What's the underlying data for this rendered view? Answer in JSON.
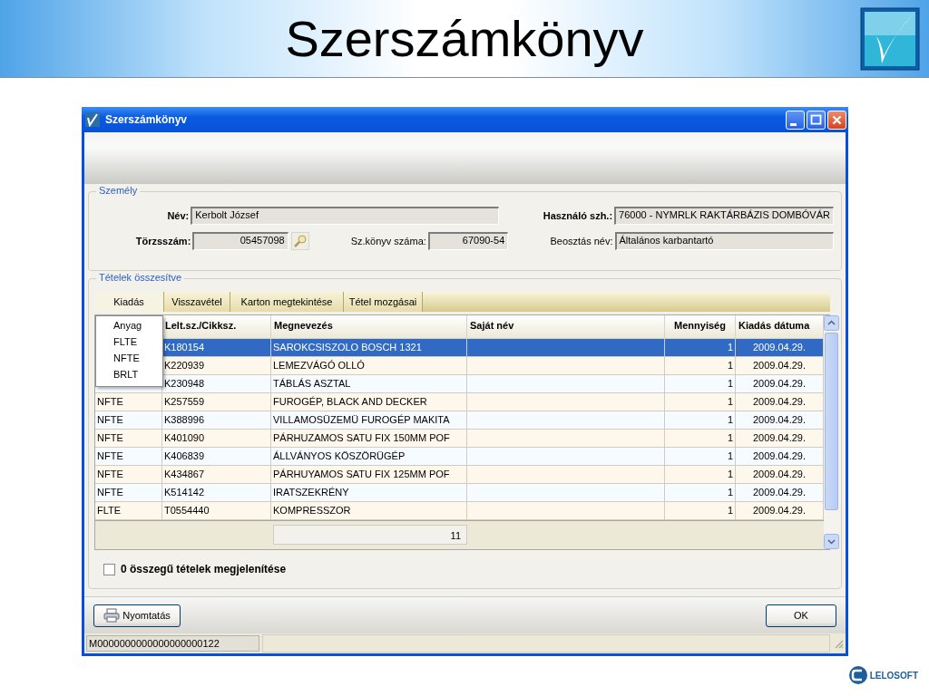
{
  "slide": {
    "title": "Szerszámkönyv",
    "footer_logo": "LELOSOFT"
  },
  "window": {
    "title": "Szerszámkönyv"
  },
  "person": {
    "legend": "Személy",
    "name": {
      "label": "Név:",
      "value": "Kerbolt József"
    },
    "user_dept": {
      "label": "Használó szh.:",
      "value": "76000 - NYMRLK RAKTÁRBÁZIS DOMBÓVÁR"
    },
    "id_number": {
      "label": "Törzsszám:",
      "value": "05457098"
    },
    "book_number": {
      "label": "Sz.könyv száma:",
      "value": "67090-54"
    },
    "position": {
      "label": "Beosztás név:",
      "value": "Általános karbantartó"
    }
  },
  "items": {
    "legend": "Tételek összesítve",
    "tabs": [
      {
        "label": "Kiadás",
        "selected": true
      },
      {
        "label": "Visszavétel",
        "selected": false
      },
      {
        "label": "Karton megtekintése",
        "selected": false
      },
      {
        "label": "Tétel mozgásai",
        "selected": false
      }
    ],
    "dropdown": [
      "Anyag",
      "FLTE",
      "NFTE",
      "BRLT"
    ],
    "columns": [
      "Lelt.sz./Cikksz.",
      "Megnevezés",
      "Saját név",
      "Mennyiség",
      "Kiadás dátuma"
    ],
    "rows": [
      {
        "number": "K180154",
        "name": "SAROKCSISZOLO BOSCH 1321",
        "quantity": "1",
        "date": "2009.04.29.",
        "selected": true
      },
      {
        "number": "K220939",
        "name": "LEMEZVÁGÓ OLLÓ",
        "quantity": "1",
        "date": "2009.04.29.",
        "selected": false
      },
      {
        "number": "K230948",
        "name": "TÁBLÁS ASZTAL",
        "quantity": "1",
        "date": "2009.04.29.",
        "selected": false
      },
      {
        "type": "NFTE",
        "number": "K257559",
        "name": "FUROGÉP, BLACK AND DECKER",
        "quantity": "1",
        "date": "2009.04.29.",
        "selected": false
      },
      {
        "type": "NFTE",
        "number": "K388996",
        "name": "VILLAMOSÜZEMÜ FUROGÉP MAKITA",
        "quantity": "1",
        "date": "2009.04.29.",
        "selected": false
      },
      {
        "type": "NFTE",
        "number": "K401090",
        "name": "PÁRHUZAMOS SATU FIX 150MM POF",
        "quantity": "1",
        "date": "2009.04.29.",
        "selected": false
      },
      {
        "type": "NFTE",
        "number": "K406839",
        "name": "ÁLLVÁNYOS KÖSZÖRÜGÉP",
        "quantity": "1",
        "date": "2009.04.29.",
        "selected": false
      },
      {
        "type": "NFTE",
        "number": "K434867",
        "name": "PÁRHUYAMOS SATU FIX 125MM POF",
        "quantity": "1",
        "date": "2009.04.29.",
        "selected": false
      },
      {
        "type": "NFTE",
        "number": "K514142",
        "name": "IRATSZEKRÉNY",
        "quantity": "1",
        "date": "2009.04.29.",
        "selected": false
      },
      {
        "type": "FLTE",
        "number": "T0554440",
        "name": "KOMPRESSZOR",
        "quantity": "1",
        "date": "2009.04.29.",
        "selected": false
      }
    ],
    "total": "11",
    "zero_items": {
      "label": "0 összegű tételek megjelenítése",
      "checked": false
    }
  },
  "buttons": {
    "print": "Nyomtatás",
    "ok": "OK"
  },
  "status_bar": "M0000000000000000000122"
}
